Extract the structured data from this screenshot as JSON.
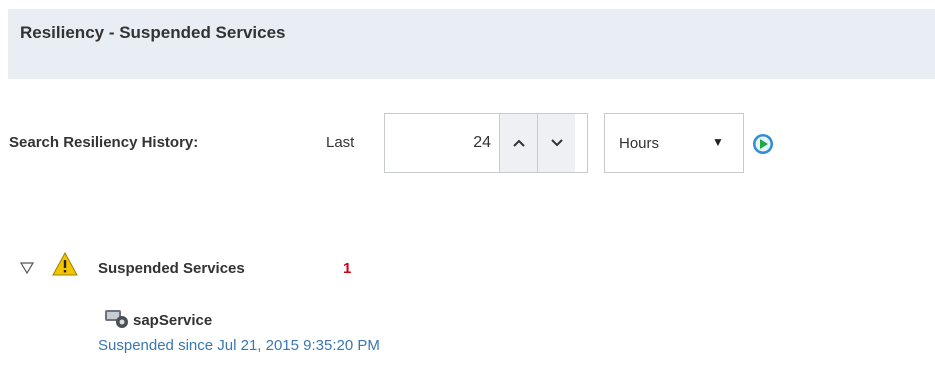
{
  "header": {
    "title": "Resiliency - Suspended Services"
  },
  "search": {
    "label": "Search Resiliency History:",
    "last_label": "Last",
    "value": "24",
    "unit_selected": "Hours",
    "icons": {
      "up": "chevron-up-icon",
      "down": "chevron-down-icon",
      "select": "dropdown-arrow-icon",
      "go": "go-arrow-icon"
    }
  },
  "tree": {
    "title": "Suspended Services",
    "count": "1",
    "icons": {
      "toggle": "expand-triangle-icon",
      "warning": "warning-icon"
    },
    "items": [
      {
        "name": "sapService",
        "status": "Suspended since Jul 21, 2015 9:35:20 PM",
        "icon": "service-gear-icon"
      }
    ]
  },
  "colors": {
    "header_bg": "#e9eef4",
    "link": "#3a76b0",
    "count": "#d0021b",
    "warning": "#f2c500",
    "go": "#2f8fd0"
  }
}
